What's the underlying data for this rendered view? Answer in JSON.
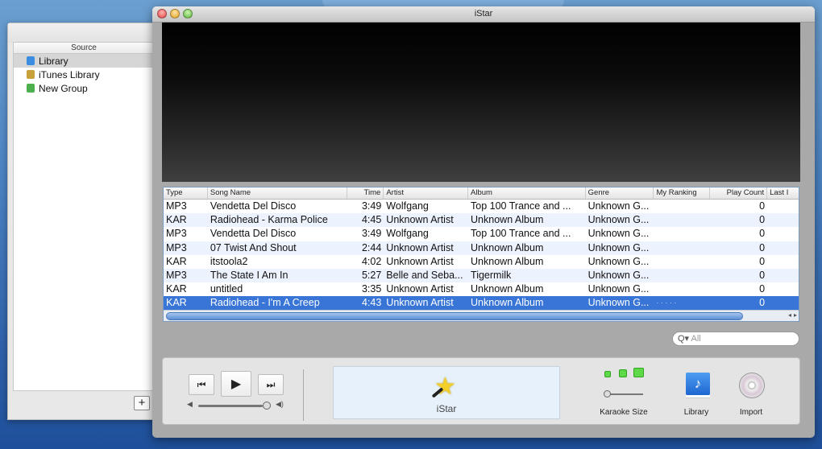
{
  "source_window": {
    "header": "Source",
    "items": [
      {
        "label": "Library",
        "icon": "library-icon",
        "color": "#3a8de0",
        "selected": true
      },
      {
        "label": "iTunes Library",
        "icon": "itunes-library-icon",
        "color": "#c9a13a",
        "selected": false
      },
      {
        "label": "New Group",
        "icon": "group-icon",
        "color": "#4cb04c",
        "selected": false
      }
    ],
    "add_button": "+"
  },
  "window": {
    "title": "iStar"
  },
  "table": {
    "columns": [
      "Type",
      "Song Name",
      "Time",
      "Artist",
      "Album",
      "Genre",
      "My Ranking",
      "Play Count",
      "Last I"
    ],
    "rows": [
      {
        "type": "MP3",
        "song": "Vendetta Del Disco",
        "time": "3:49",
        "artist": "Wolfgang",
        "album": "Top 100 Trance and ...",
        "genre": "Unknown G...",
        "ranking": "",
        "plays": "0"
      },
      {
        "type": "KAR",
        "song": "Radiohead - Karma Police",
        "time": "4:45",
        "artist": "Unknown Artist",
        "album": "Unknown Album",
        "genre": "Unknown G...",
        "ranking": "",
        "plays": "0"
      },
      {
        "type": "MP3",
        "song": "Vendetta Del Disco",
        "time": "3:49",
        "artist": "Wolfgang",
        "album": "Top 100 Trance and ...",
        "genre": "Unknown G...",
        "ranking": "",
        "plays": "0"
      },
      {
        "type": "MP3",
        "song": "07 Twist And Shout",
        "time": "2:44",
        "artist": "Unknown Artist",
        "album": "Unknown Album",
        "genre": "Unknown G...",
        "ranking": "",
        "plays": "0"
      },
      {
        "type": "KAR",
        "song": "itstoola2",
        "time": "4:02",
        "artist": "Unknown Artist",
        "album": "Unknown Album",
        "genre": "Unknown G...",
        "ranking": "",
        "plays": "0"
      },
      {
        "type": "MP3",
        "song": "The State I Am In",
        "time": "5:27",
        "artist": "Belle and Seba...",
        "album": "Tigermilk",
        "genre": "Unknown G...",
        "ranking": "",
        "plays": "0"
      },
      {
        "type": "KAR",
        "song": "untitled",
        "time": "3:35",
        "artist": "Unknown Artist",
        "album": "Unknown Album",
        "genre": "Unknown G...",
        "ranking": "",
        "plays": "0"
      },
      {
        "type": "KAR",
        "song": "Radiohead - I'm A Creep",
        "time": "4:43",
        "artist": "Unknown Artist",
        "album": "Unknown Album",
        "genre": "Unknown G...",
        "ranking": "· · · · ·",
        "plays": "0",
        "selected": true
      }
    ]
  },
  "search": {
    "icon": "Q▾",
    "placeholder": "All"
  },
  "controls": {
    "prev": "⏮",
    "play": "▶",
    "next": "⏭",
    "volume": 1.0,
    "lcd_label": "iStar",
    "karaoke_size_label": "Karaoke Size",
    "library_label": "Library",
    "import_label": "Import"
  },
  "colors": {
    "selection": "#3875d7",
    "alt_row": "#edf3fe"
  }
}
